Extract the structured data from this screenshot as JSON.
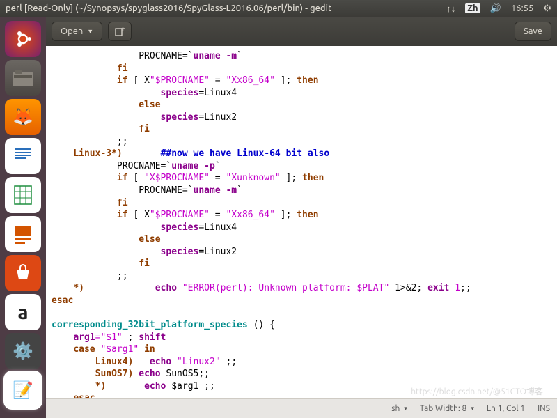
{
  "topbar": {
    "title": "perl [Read-Only] (~/Synopsys/spyglass2016/SpyGlass-L2016.06/perl/bin) - gedit",
    "ime": "Zh",
    "time": "16:55"
  },
  "toolbar": {
    "open": "Open",
    "save": "Save"
  },
  "code": {
    "procname_eq": "PROCNAME=",
    "uname_m": "uname -m",
    "uname_p": "uname -p",
    "fi": "fi",
    "if": "if",
    "then": "then",
    "else": "else",
    "echo": "echo",
    "case": "case",
    "in": "in",
    "exit": "exit",
    "esac": "esac",
    "shift": "shift",
    "br_open": " [ ",
    "X": "X",
    "var_proc": "\"$PROCNAME\"",
    "var_proc_x": "\"X$PROCNAME\"",
    "eq": " = ",
    "xx86": "\"Xx86_64\"",
    "xunk": "\"Xunknown\"",
    "br_close": " ]; ",
    "species_eq": "species",
    "linux4": "=Linux4",
    "linux2": "=Linux2",
    "dsemi": ";;",
    "linux3_case": "Linux-3*)",
    "comment1": "##now we have Linux-64 bit also",
    "star_case": "*)",
    "err_str": "\"ERROR(perl): Unknown platform: $PLAT\"",
    "redir": " 1>&2; ",
    "one": "1",
    "fn_name": "corresponding_32bit_platform_species",
    "fn_paren": " () {",
    "arg1_eq": "arg1",
    "dollar1": "=\"$1\"",
    "semi": " ; ",
    "var_arg1": "\"$arg1\"",
    "c_linux4": "Linux4)",
    "str_linux2": "\"Linux2\"",
    "c_sunos7": "SunOS7)",
    "sunos5": " SunOS5",
    "plain_arg1": " $arg1 ",
    "rbrace": "}"
  },
  "statusbar": {
    "lang": "sh",
    "tabw": "Tab Width: 8",
    "pos": "Ln 1, Col 1",
    "ins": "INS"
  },
  "watermark": "https://blog.csdn.net/@51CTO博客"
}
